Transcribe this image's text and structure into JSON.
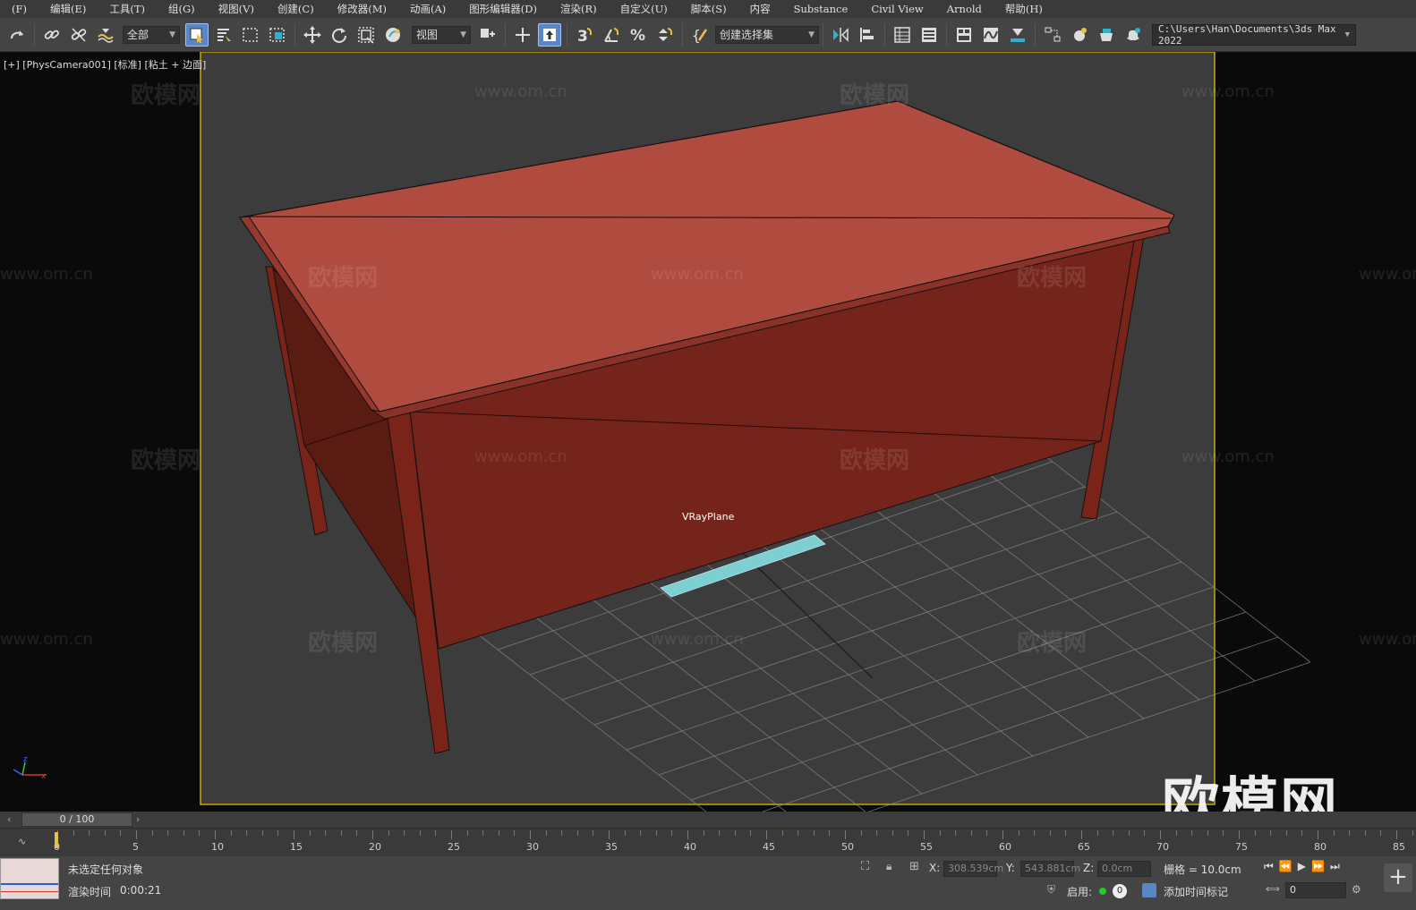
{
  "menu": [
    "(F)",
    "编辑(E)",
    "工具(T)",
    "组(G)",
    "视图(V)",
    "创建(C)",
    "修改器(M)",
    "动画(A)",
    "图形编辑器(D)",
    "渲染(R)",
    "自定义(U)",
    "脚本(S)",
    "内容",
    "Substance",
    "Civil View",
    "Arnold",
    "帮助(H)"
  ],
  "toolbar": {
    "filter_value": "全部",
    "ref_coord_value": "视图",
    "selection_set_value": "创建选择集",
    "path_value": "C:\\Users\\Han\\Documents\\3ds Max 2022",
    "icons": [
      "redo-icon",
      "link-icon",
      "unlink-icon",
      "bind-spacewarp-icon",
      "select-icon",
      "select-by-name-icon",
      "rect-region-icon",
      "window-crossing-icon",
      "move-icon",
      "rotate-icon",
      "scale-icon",
      "placement-icon",
      "pivot-icon",
      "manipulate-icon",
      "keyboard-shortcut-icon",
      "snap-3-icon",
      "angle-snap-icon",
      "percent-snap-icon",
      "spinner-snap-icon",
      "edit-named-sets-icon",
      "mirror-icon",
      "align-icon",
      "scene-explorer-icon",
      "layer-explorer-icon",
      "ribbon-icon",
      "curve-editor-icon",
      "dope-sheet-icon",
      "schematic-icon",
      "material-editor-icon",
      "render-setup-icon",
      "render-frame-icon",
      "render-icon"
    ]
  },
  "viewport": {
    "label": "[+] [PhysCamera001] [标准] [粘土 + 边面]",
    "object_label": "VRayPlane",
    "watermark_text": "欧模网",
    "watermark_url": "www.om.cn",
    "big_watermark": "欧模网",
    "colors": {
      "table_top": "#b04b40",
      "table_side": "#7a2318",
      "plane": "#7ecfcf",
      "frame_border": "#c8a800",
      "bg": "#3c3c3c"
    }
  },
  "timeline": {
    "slider_label": "0 / 100",
    "ticks": [
      "0",
      "5",
      "10",
      "15",
      "20",
      "25",
      "30",
      "35",
      "40",
      "45",
      "50",
      "55",
      "60",
      "65",
      "70",
      "75",
      "80",
      "85"
    ]
  },
  "status": {
    "selection": "未选定任何对象",
    "render_time_label": "渲染时间",
    "render_time": "0:00:21",
    "x_label": "X:",
    "x_value": "308.539cm",
    "y_label": "Y:",
    "y_value": "543.881cm",
    "z_label": "Z:",
    "z_value": "0.0cm",
    "grid_label": "栅格 = 10.0cm",
    "enable_label": "启用:",
    "enable_count": "0",
    "add_time_tag": "添加时间标记",
    "frame_value": "0"
  }
}
